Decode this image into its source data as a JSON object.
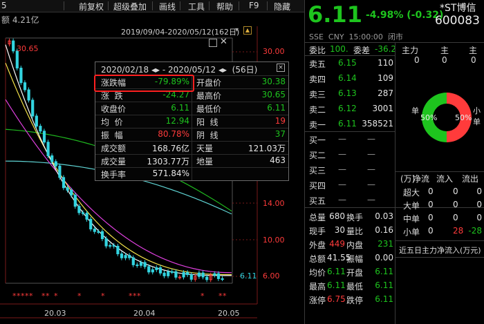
{
  "toolbar": {
    "left_fragment": "5",
    "items": [
      "前复权",
      "超级叠加",
      "画线",
      "工具",
      "帮助",
      "F9",
      "隐藏"
    ]
  },
  "info_bar": {
    "amount": "额 4.21亿"
  },
  "chart": {
    "date_range": "2019/09/04-2020/05/12(162日)",
    "price_high_label": "30.65",
    "price_low_label": "6.11",
    "y_ticks": [
      "30.00",
      "14.00",
      "10.00",
      "6.00"
    ],
    "x_ticks": [
      "20.03",
      "20.04",
      "20.05"
    ],
    "colors": {
      "up": "#ff3b3b",
      "down": "#33d4e0",
      "ma5": "#ffffff",
      "ma10": "#f4e34a",
      "ma20": "#e040e0",
      "ma60": "#1fb81f",
      "ma120": "#5fd4d4"
    }
  },
  "stats": {
    "header": "2020/02/18 ◂▸ - 2020/05/12 ◂▸  (56日)",
    "close_icon": "close-icon",
    "rows": [
      {
        "l1": "涨跌幅",
        "v1": "-79.89%",
        "c1": "grn",
        "l2": "开盘价",
        "v2": "30.38",
        "c2": "grn"
      },
      {
        "l1": "涨  跌",
        "v1": "-24.27",
        "c1": "grn",
        "l2": "最高价",
        "v2": "30.65",
        "c2": "grn"
      },
      {
        "l1": "收盘价",
        "v1": "6.11",
        "c1": "grn",
        "l2": "最低价",
        "v2": "6.11",
        "c2": "grn"
      },
      {
        "l1": "均  价",
        "v1": "12.94",
        "c1": "grn",
        "l2": "阳  线",
        "v2": "19",
        "c2": "red"
      },
      {
        "l1": "振  幅",
        "v1": "80.78%",
        "c1": "red",
        "l2": "阴  线",
        "v2": "37",
        "c2": "grn"
      },
      {
        "l1": "成交额",
        "v1": "168.76亿",
        "c1": "wht",
        "l2": "天量",
        "v2": "121.03万",
        "c2": "wht"
      },
      {
        "l1": "成交量",
        "v1": "1303.77万",
        "c1": "wht",
        "l2": "地量",
        "v2": "463",
        "c2": "wht"
      },
      {
        "l1": "换手率",
        "v1": "571.84%",
        "c1": "wht",
        "l2": "",
        "v2": "",
        "c2": "wht"
      }
    ]
  },
  "quote": {
    "price": "6.11",
    "change": "-4.98% (-0.32)",
    "name": "*ST博信",
    "code": "600083",
    "meta": "SSE  CNY  15:00:00  闭市",
    "ratio_label": "委比",
    "ratio_value": "100.",
    "diff_label": "委差",
    "diff_value": "-36.2",
    "sells": [
      {
        "label": "卖五",
        "price": "6.15",
        "vol": "110"
      },
      {
        "label": "卖四",
        "price": "6.14",
        "vol": "109"
      },
      {
        "label": "卖三",
        "price": "6.13",
        "vol": "287"
      },
      {
        "label": "卖二",
        "price": "6.12",
        "vol": "3001"
      },
      {
        "label": "卖一",
        "price": "6.11",
        "vol": "358521"
      }
    ],
    "buys": [
      "买一",
      "买二",
      "买三",
      "买四",
      "买五"
    ],
    "stats": [
      {
        "l1": "总量",
        "v1": "680",
        "c1": "wht",
        "l2": "换手",
        "v2": "0.03",
        "c2": "wht"
      },
      {
        "l1": "现手",
        "v1": "30",
        "c1": "wht",
        "l2": "量比",
        "v2": "0.16",
        "c2": "wht"
      },
      {
        "l1": "外盘",
        "v1": "449",
        "c1": "red",
        "l2": "内盘",
        "v2": "231",
        "c2": "grn"
      },
      {
        "l1": "总额",
        "v1": "41.55",
        "c1": "wht",
        "l2": "振幅",
        "v2": "0.00",
        "c2": "wht"
      },
      {
        "l1": "均价",
        "v1": "6.11",
        "c1": "grn",
        "l2": "开盘",
        "v2": "6.11",
        "c2": "grn"
      },
      {
        "l1": "最高",
        "v1": "6.11",
        "c1": "grn",
        "l2": "最低",
        "v2": "6.11",
        "c2": "grn"
      },
      {
        "l1": "涨停",
        "v1": "6.75",
        "c1": "red",
        "l2": "跌停",
        "v2": "6.11",
        "c2": "grn"
      }
    ]
  },
  "flow": {
    "headers": [
      "主力",
      "主",
      "主"
    ],
    "values": [
      "0",
      "0",
      "0"
    ],
    "pie_left": "单",
    "pie_right": "小单",
    "pie_left_pct": "50%",
    "pie_right_pct": "50%",
    "pie_inflow_fraction": 0.5,
    "table_header": [
      "(万)",
      "净流",
      "流入",
      "流出"
    ],
    "rows": [
      {
        "label": "超大",
        "net": "0",
        "in": "0",
        "out": "0",
        "cn": "wht",
        "ci": "wht",
        "co": "wht"
      },
      {
        "label": "大单",
        "net": "0",
        "in": "0",
        "out": "0",
        "cn": "wht",
        "ci": "wht",
        "co": "wht"
      },
      {
        "label": "中单",
        "net": "0",
        "in": "0",
        "out": "0",
        "cn": "wht",
        "ci": "wht",
        "co": "wht"
      },
      {
        "label": "小单",
        "net": "0",
        "in": "28",
        "out": "-28",
        "cn": "wht",
        "ci": "red",
        "co": "grn"
      }
    ],
    "five_day": "近五日主力净流入(万元)"
  }
}
